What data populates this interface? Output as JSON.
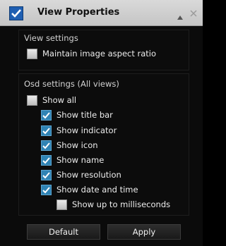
{
  "window": {
    "title": "View Properties"
  },
  "view_settings": {
    "label": "View settings",
    "maintain_aspect": {
      "label": "Maintain image aspect ratio",
      "checked": false
    }
  },
  "osd_settings": {
    "label": "Osd settings (All views)",
    "items": [
      {
        "label": "Show all",
        "checked": false
      },
      {
        "label": "Show title bar",
        "checked": true
      },
      {
        "label": "Show indicator",
        "checked": true
      },
      {
        "label": "Show icon",
        "checked": true
      },
      {
        "label": "Show name",
        "checked": true
      },
      {
        "label": "Show resolution",
        "checked": true
      },
      {
        "label": "Show date and time",
        "checked": true
      },
      {
        "label": "Show up to milliseconds",
        "checked": false
      }
    ]
  },
  "buttons": {
    "default_label": "Default",
    "apply_label": "Apply"
  },
  "colors": {
    "check_accent": "#2f83b4",
    "titlebar": "#d0d0d0",
    "background": "#0b0b0b"
  }
}
